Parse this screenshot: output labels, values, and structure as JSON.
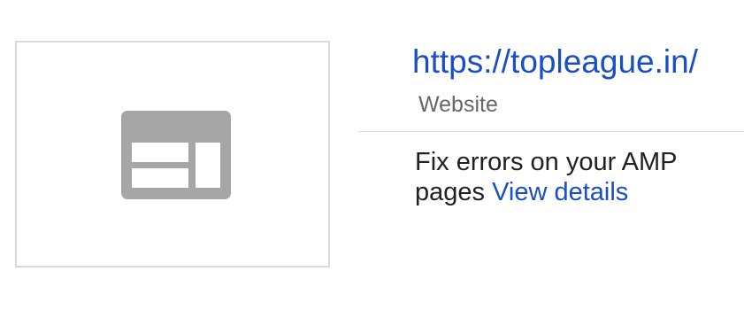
{
  "result": {
    "url": "https://topleague.in/",
    "type_label": "Website",
    "message": "Fix errors on your AMP pages",
    "details_link": "View details",
    "thumbnail_icon": "webpage-placeholder-icon"
  },
  "colors": {
    "link": "#1a4fc4",
    "secondary_text": "#666666",
    "body_text": "#212121",
    "border": "#d9d9d9",
    "icon_gray": "#a6a6a6"
  }
}
